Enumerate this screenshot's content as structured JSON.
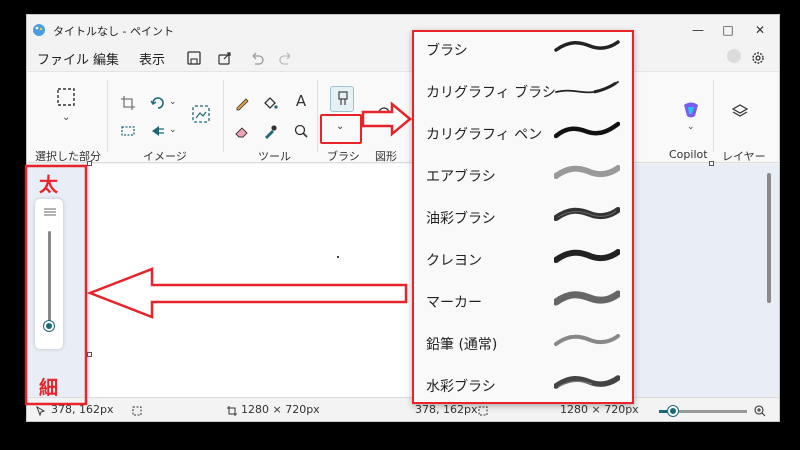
{
  "window": {
    "title": "タイトルなし - ペイント"
  },
  "menu": {
    "file": "ファイル",
    "edit": "編集",
    "view": "表示"
  },
  "ribbon": {
    "selection_label": "選択した部分",
    "image_label": "イメージ",
    "tools_label": "ツール",
    "brush_label": "ブラシ",
    "shapes_label": "図形",
    "copilot_label": "Copilot",
    "layers_label": "レイヤー",
    "text_tool_glyph": "A"
  },
  "annotation": {
    "thick": "太",
    "thin": "細"
  },
  "status": {
    "cursor_pos": "378, 162px",
    "canvas_size": "1280 × 720px",
    "cursor_pos_2": "378, 162px",
    "canvas_size_2": "1280 × 720px"
  },
  "brushes": [
    {
      "label": "ブラシ",
      "icon": "brush-stroke-icon"
    },
    {
      "label": "カリグラフィ ブラシ",
      "icon": "calligraphy-brush-stroke-icon"
    },
    {
      "label": "カリグラフィ ペン",
      "icon": "calligraphy-pen-stroke-icon"
    },
    {
      "label": "エアブラシ",
      "icon": "airbrush-stroke-icon"
    },
    {
      "label": "油彩ブラシ",
      "icon": "oil-brush-stroke-icon"
    },
    {
      "label": "クレヨン",
      "icon": "crayon-stroke-icon"
    },
    {
      "label": "マーカー",
      "icon": "marker-stroke-icon"
    },
    {
      "label": "鉛筆 (通常)",
      "icon": "pencil-stroke-icon"
    },
    {
      "label": "水彩ブラシ",
      "icon": "watercolor-brush-stroke-icon"
    }
  ],
  "colors": {
    "highlight": "#e8232a",
    "accent": "#1c6a78",
    "copilot": "#7b5cf0"
  }
}
